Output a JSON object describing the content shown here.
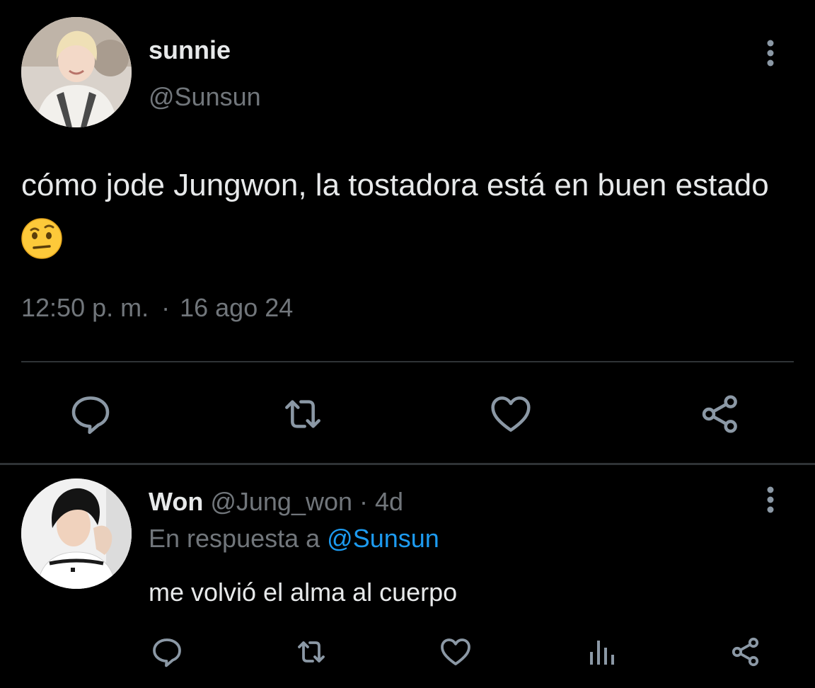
{
  "tweet": {
    "author": {
      "display_name": "sunnie",
      "handle": "@Sunsun"
    },
    "text": "cómo jode Jungwon, la tostadora está en buen estado",
    "emoji": "face-with-raised-eyebrow",
    "time": "12:50 p. m.",
    "separator": "·",
    "date": "16 ago 24",
    "actions": [
      "reply-icon",
      "retweet-icon",
      "like-icon",
      "share-icon"
    ]
  },
  "reply": {
    "author": {
      "display_name": "Won",
      "handle": "@Jung_won",
      "age": "· 4d"
    },
    "replying_to_label": "En respuesta a",
    "replying_to_handle": "@Sunsun",
    "text": "me volvió el alma al cuerpo",
    "actions": [
      "reply-icon",
      "retweet-icon",
      "like-icon",
      "analytics-icon",
      "share-icon"
    ]
  },
  "colors": {
    "background": "#000000",
    "text_primary": "#e7e9ea",
    "text_secondary": "#71767b",
    "icon": "#8b98a5",
    "link": "#1d9bf0",
    "divider": "#2f3336"
  }
}
